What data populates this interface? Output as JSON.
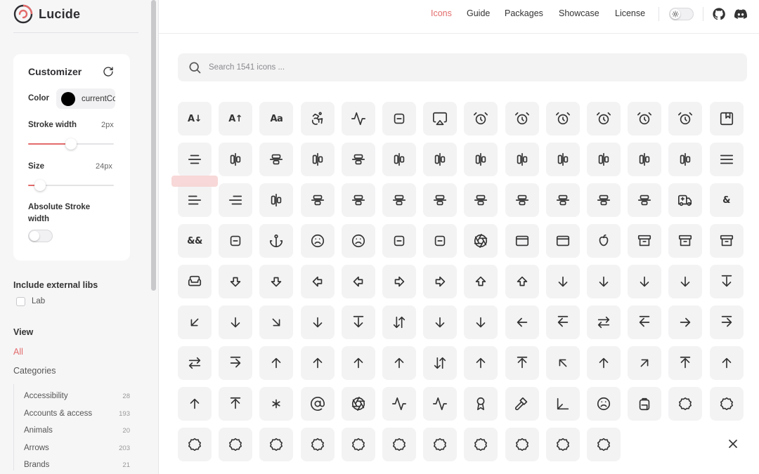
{
  "app": {
    "name": "Lucide"
  },
  "nav": [
    {
      "label": "Icons",
      "active": true
    },
    {
      "label": "Guide",
      "active": false
    },
    {
      "label": "Packages",
      "active": false
    },
    {
      "label": "Showcase",
      "active": false
    },
    {
      "label": "License",
      "active": false
    }
  ],
  "customizer": {
    "title": "Customizer",
    "color_label": "Color",
    "color_value": "currentColor",
    "stroke_label": "Stroke width",
    "stroke_value": "2px",
    "stroke_fraction": 0.5,
    "size_label": "Size",
    "size_value": "24px",
    "size_fraction": 0.14,
    "absolute_label": "Absolute Stroke width",
    "absolute_on": false
  },
  "external": {
    "title": "Include external libs",
    "lab_label": "Lab"
  },
  "view": {
    "title": "View",
    "all_label": "All",
    "categories_label": "Categories"
  },
  "categories": [
    {
      "name": "Accessibility",
      "count": "28"
    },
    {
      "name": "Accounts & access",
      "count": "193"
    },
    {
      "name": "Animals",
      "count": "20"
    },
    {
      "name": "Arrows",
      "count": "203"
    },
    {
      "name": "Brands",
      "count": "21"
    }
  ],
  "search": {
    "placeholder": "Search 1541 icons ..."
  },
  "colors": {
    "accent": "#e36b6b",
    "tile": "#f3f3f4",
    "sidebar": "#f6f6f7"
  },
  "icons": [
    [
      "a-arrow-down",
      "a-arrow-up",
      "a-large-small",
      "accessibility",
      "activity",
      "air-vent",
      "airplay",
      "alarm-clock",
      "alarm-clock-check",
      "alarm-clock-minus",
      "alarm-clock-off",
      "alarm-clock-plus",
      "alarm-smoke",
      "album"
    ],
    [
      "align-center",
      "align-center-horizontal",
      "align-center-vertical",
      "align-end-horizontal",
      "align-end-vertical",
      "align-horizontal-distribute-center",
      "align-horizontal-distribute-end",
      "align-horizontal-distribute-start",
      "align-horizontal-justify-center",
      "align-horizontal-justify-end",
      "align-horizontal-justify-start",
      "align-horizontal-space-around",
      "align-horizontal-space-between",
      "align-justify"
    ],
    [
      "align-left",
      "align-right",
      "align-start-horizontal",
      "align-start-vertical",
      "align-vertical-distribute-center",
      "align-vertical-distribute-end",
      "align-vertical-distribute-start",
      "align-vertical-justify-center",
      "align-vertical-justify-end",
      "align-vertical-justify-start",
      "align-vertical-space-around",
      "align-vertical-space-between",
      "ambulance",
      "ampersand"
    ],
    [
      "ampersands",
      "amphora",
      "anchor",
      "angry",
      "annoyed",
      "antenna",
      "anvil",
      "aperture",
      "app-window",
      "app-window-mac",
      "apple",
      "archive",
      "archive-restore",
      "archive-x"
    ],
    [
      "armchair",
      "arrow-big-down",
      "arrow-big-down-dash",
      "arrow-big-left",
      "arrow-big-left-dash",
      "arrow-big-right",
      "arrow-big-right-dash",
      "arrow-big-up",
      "arrow-big-up-dash",
      "arrow-down",
      "arrow-down-0-1",
      "arrow-down-1-0",
      "arrow-down-a-z",
      "arrow-down-from-line"
    ],
    [
      "arrow-down-left",
      "arrow-down-narrow-wide",
      "arrow-down-right",
      "arrow-down-to-dot",
      "arrow-down-to-line",
      "arrow-down-up",
      "arrow-down-wide-narrow",
      "arrow-down-z-a",
      "arrow-left",
      "arrow-left-from-line",
      "arrow-left-right",
      "arrow-left-to-line",
      "arrow-right",
      "arrow-right-from-line"
    ],
    [
      "arrow-right-left",
      "arrow-right-to-line",
      "arrow-up",
      "arrow-up-0-1",
      "arrow-up-1-0",
      "arrow-up-a-z",
      "arrow-up-down",
      "arrow-up-from-dot",
      "arrow-up-from-line",
      "arrow-up-left",
      "arrow-up-narrow-wide",
      "arrow-up-right",
      "arrow-up-to-line",
      "arrow-up-wide-narrow"
    ],
    [
      "arrow-up-z-a",
      "arrows-up-from-line",
      "asterisk",
      "at-sign",
      "atom",
      "audio-lines",
      "audio-waveform",
      "award",
      "axe",
      "axis-3d",
      "baby",
      "backpack",
      "badge",
      "badge-alert"
    ],
    [
      "badge-cent",
      "badge-check",
      "badge-dollar-sign",
      "badge-euro",
      "badge-help",
      "badge-indian-rupee",
      "badge-info",
      "badge-japanese-yen",
      "badge-minus",
      "badge-percent",
      "badge-plus"
    ]
  ]
}
